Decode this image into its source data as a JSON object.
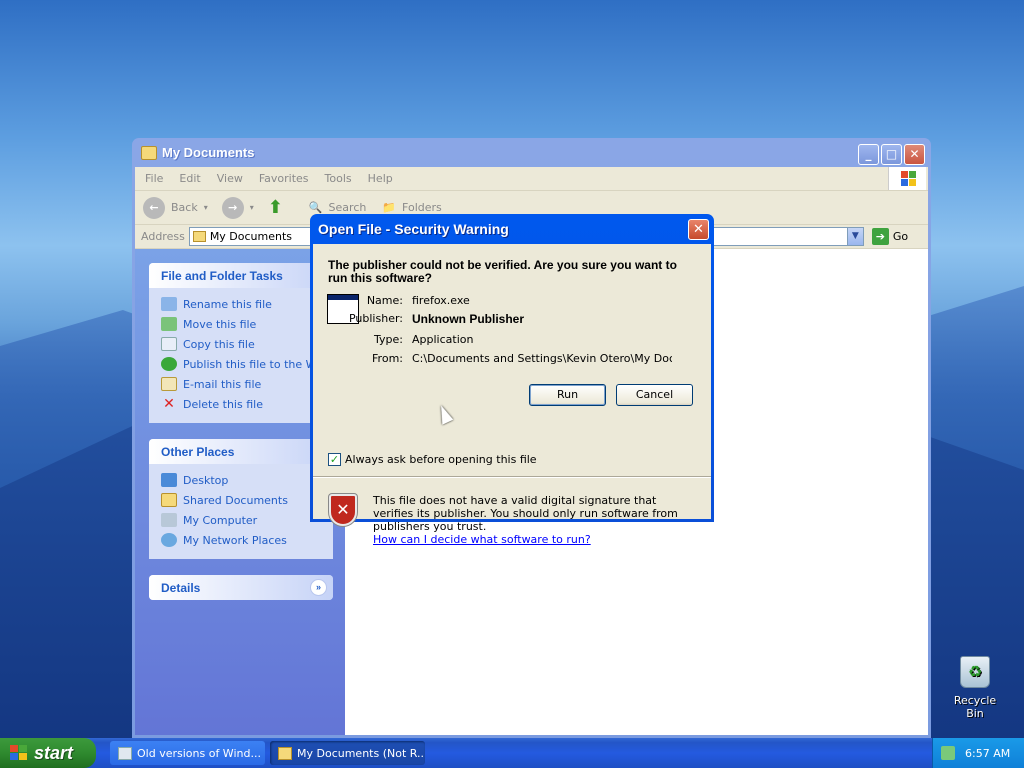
{
  "explorer": {
    "title": "My Documents",
    "menu": [
      "File",
      "Edit",
      "View",
      "Favorites",
      "Tools",
      "Help"
    ],
    "toolbar": {
      "back": "Back",
      "search": "Search",
      "folders": "Folders"
    },
    "address_label": "Address",
    "address_value": "My Documents",
    "go_label": "Go",
    "file_tasks": {
      "title": "File and Folder Tasks",
      "items": [
        "Rename this file",
        "Move this file",
        "Copy this file",
        "Publish this file to the Web",
        "E-mail this file",
        "Delete this file"
      ]
    },
    "other_places": {
      "title": "Other Places",
      "items": [
        "Desktop",
        "Shared Documents",
        "My Computer",
        "My Network Places"
      ]
    },
    "details": {
      "title": "Details"
    }
  },
  "dialog": {
    "title": "Open File - Security Warning",
    "question": "The publisher could not be verified.  Are you sure you want to run this software?",
    "fields": {
      "name_label": "Name:",
      "name_value": "firefox.exe",
      "publisher_label": "Publisher:",
      "publisher_value": "Unknown Publisher",
      "type_label": "Type:",
      "type_value": "Application",
      "from_label": "From:",
      "from_value": "C:\\Documents and Settings\\Kevin Otero\\My Docum..."
    },
    "run_label": "Run",
    "cancel_label": "Cancel",
    "checkbox_label": "Always ask before opening this file",
    "checkbox_checked": true,
    "warning_text": "This file does not have a valid digital signature that verifies its publisher.  You should only run software from publishers you trust.",
    "warning_link": "How can I decide what software to run?"
  },
  "desktop": {
    "recycle_bin": "Recycle Bin"
  },
  "taskbar": {
    "start_label": "start",
    "tasks": [
      "Old versions of Wind...",
      "My Documents (Not R..."
    ],
    "clock": "6:57 AM"
  }
}
